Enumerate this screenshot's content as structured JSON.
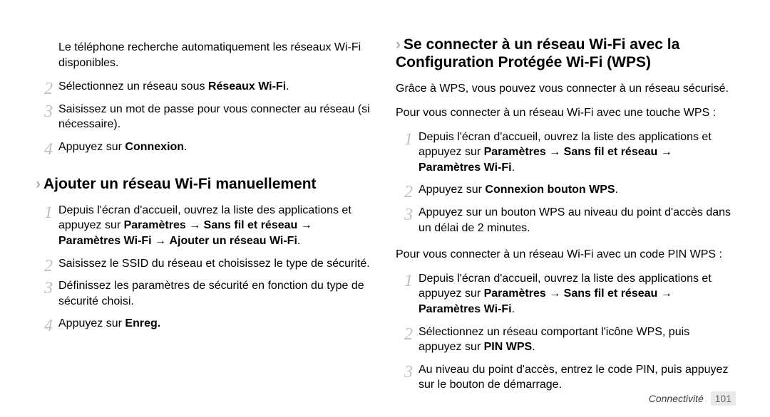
{
  "left": {
    "intro": "Le téléphone recherche automatiquement les réseaux Wi-Fi disponibles.",
    "stepsA": {
      "s2_pre": "Sélectionnez un réseau sous ",
      "s2_bold": "Réseaux Wi-Fi",
      "s2_post": ".",
      "s3": "Saisissez un mot de passe pour vous connecter au réseau (si nécessaire).",
      "s4_pre": "Appuyez sur ",
      "s4_bold": "Connexion",
      "s4_post": "."
    },
    "heading": "Ajouter un réseau Wi-Fi manuellement",
    "stepsB": {
      "s1_pre": "Depuis l'écran d'accueil, ouvrez la liste des applications et appuyez sur ",
      "s1_bold1": "Paramètres",
      "s1_mid1": " → ",
      "s1_bold2": "Sans fil et réseau",
      "s1_mid2": " → ",
      "s1_bold3": "Paramètres Wi-Fi",
      "s1_mid3": " → ",
      "s1_bold4": "Ajouter un réseau Wi-Fi",
      "s1_post": ".",
      "s2": "Saisissez le SSID du réseau et choisissez le type de sécurité.",
      "s3": "Définissez les paramètres de sécurité en fonction du type de sécurité choisi.",
      "s4_pre": "Appuyez sur ",
      "s4_bold": "Enreg.",
      "s4_post": ""
    }
  },
  "right": {
    "heading": "Se connecter à un réseau Wi-Fi avec la Configuration Protégée Wi-Fi (WPS)",
    "intro": "Grâce à WPS, vous pouvez vous connecter à un réseau sécurisé.",
    "lead1": "Pour vous connecter à un réseau Wi-Fi avec une touche WPS :",
    "stepsA": {
      "s1_pre": "Depuis l'écran d'accueil, ouvrez la liste des applications et appuyez sur ",
      "s1_bold1": "Paramètres",
      "s1_mid1": " → ",
      "s1_bold2": "Sans fil et réseau",
      "s1_mid2": " → ",
      "s1_bold3": "Paramètres Wi-Fi",
      "s1_post": ".",
      "s2_pre": "Appuyez sur ",
      "s2_bold": "Connexion bouton WPS",
      "s2_post": ".",
      "s3": "Appuyez sur un bouton WPS au niveau du point d'accès dans un délai de 2 minutes."
    },
    "lead2": "Pour vous connecter à un réseau Wi-Fi avec un code PIN WPS :",
    "stepsB": {
      "s1_pre": "Depuis l'écran d'accueil, ouvrez la liste des applications et appuyez sur ",
      "s1_bold1": "Paramètres",
      "s1_mid1": " → ",
      "s1_bold2": "Sans fil et réseau",
      "s1_mid2": " → ",
      "s1_bold3": "Paramètres Wi-Fi",
      "s1_post": ".",
      "s2_pre": "Sélectionnez un réseau comportant l'icône WPS, puis appuyez sur ",
      "s2_bold": "PIN WPS",
      "s2_post": ".",
      "s3": "Au niveau du point d'accès, entrez le code PIN, puis appuyez sur le bouton de démarrage."
    }
  },
  "footer": {
    "section": "Connectivité",
    "page": "101"
  },
  "chevron": "›"
}
